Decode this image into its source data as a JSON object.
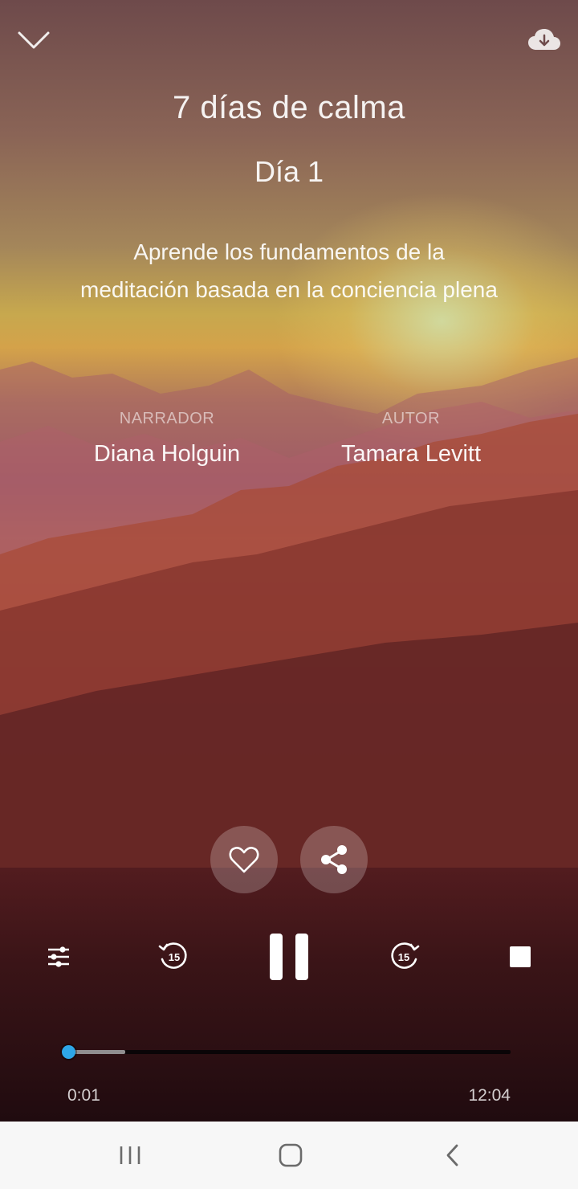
{
  "header": {
    "collapse_icon": "chevron-down-icon",
    "download_icon": "cloud-download-icon"
  },
  "session": {
    "title": "7 días de calma",
    "day": "Día 1",
    "description": "Aprende los fundamentos de la meditación basada en la conciencia plena",
    "narrator_label": "NARRADOR",
    "narrator": "Diana Holguin",
    "author_label": "AUTOR",
    "author": "Tamara Levitt"
  },
  "actions": {
    "favorite_icon": "heart-icon",
    "share_icon": "share-icon"
  },
  "controls": {
    "settings_icon": "sliders-icon",
    "rewind_icon": "rewind-15-icon",
    "rewind_seconds": "15",
    "pause_icon": "pause-icon",
    "forward_icon": "forward-15-icon",
    "forward_seconds": "15",
    "stop_icon": "stop-icon"
  },
  "playback": {
    "current_time": "0:01",
    "total_time": "12:04",
    "played_fraction": 0.0014,
    "buffered_fraction": 0.13
  },
  "system_nav": {
    "recent_icon": "recent-apps-icon",
    "home_icon": "home-icon",
    "back_icon": "back-icon"
  },
  "colors": {
    "accent": "#2ea7e8",
    "navbar_bg": "#f7f7f7"
  }
}
